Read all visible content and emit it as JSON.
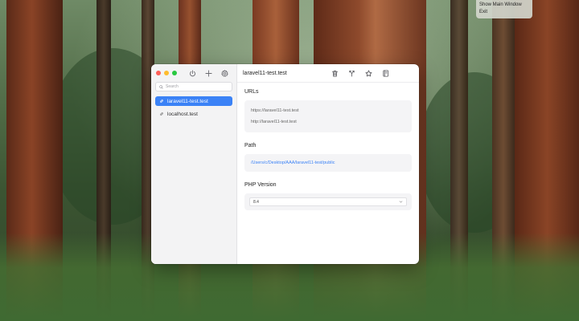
{
  "system_menu": {
    "items": [
      "Show Main Window",
      "Exit"
    ]
  },
  "window": {
    "traffic_lights": [
      "close",
      "minimize",
      "zoom"
    ],
    "sidebar": {
      "actions": [
        "power-icon",
        "plus-icon",
        "gear-icon"
      ],
      "search": {
        "placeholder": "Search",
        "value": ""
      },
      "sites": [
        {
          "label": "laravel11-test.test",
          "selected": true
        },
        {
          "label": "localhost.test",
          "selected": false
        }
      ]
    },
    "main": {
      "title": "laravel11-test.test",
      "actions": [
        "trash-icon",
        "split-icon",
        "star-icon",
        "book-icon"
      ],
      "urls": {
        "title": "URLs",
        "items": [
          "https://laravel11-test.test",
          "http://laravel11-test.test"
        ]
      },
      "path": {
        "title": "Path",
        "value": "/Users/c/Desktop/AAA/laravel11-test/public"
      },
      "php": {
        "title": "PHP Version",
        "selected": "8.4"
      }
    }
  },
  "colors": {
    "accent": "#3b82f6",
    "close": "#fe5f57",
    "minimize": "#febc2e",
    "zoom": "#28c840"
  }
}
